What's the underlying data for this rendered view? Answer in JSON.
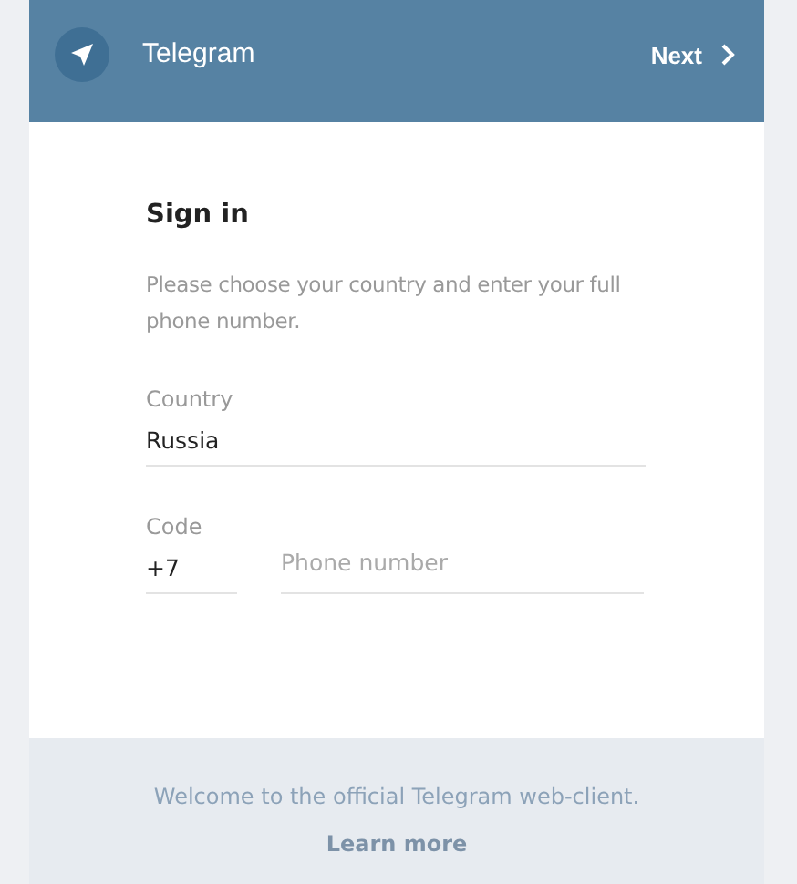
{
  "header": {
    "title": "Telegram",
    "next_button": "Next"
  },
  "sign_in": {
    "heading": "Sign in",
    "description": "Please choose your country and enter your full phone number.",
    "country": {
      "label": "Country",
      "value": "Russia"
    },
    "code": {
      "label": "Code",
      "value": "+7"
    },
    "phone": {
      "placeholder": "Phone number"
    }
  },
  "footer": {
    "welcome": "Welcome to the official Telegram web-client.",
    "link": "Learn more"
  }
}
